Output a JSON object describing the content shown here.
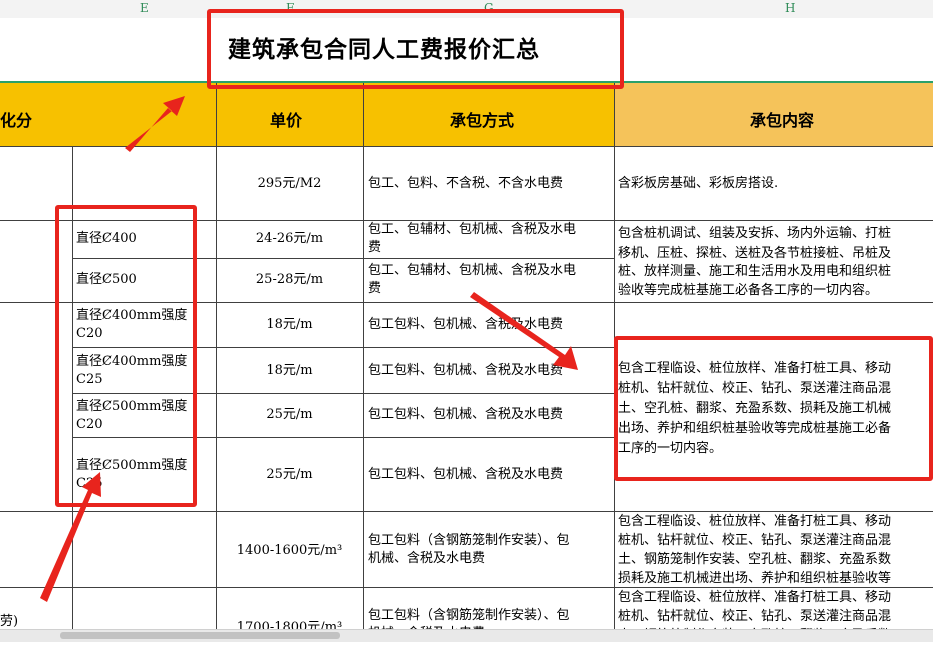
{
  "columns": [
    "E",
    "F",
    "G",
    "H"
  ],
  "title": "建筑承包合同人工费报价汇总",
  "headers": {
    "partial": "化分",
    "unit_price": "单价",
    "method": "承包方式",
    "content": "承包内容"
  },
  "left_edge_text": "劳)",
  "rows": [
    {
      "spec": "",
      "price": "295元/M2",
      "method": "包工、包料、不含税、不含水电费",
      "content": "含彩板房基础、彩板房搭设."
    },
    {
      "spec": "直径Ȼ400",
      "price": "24-26元/m",
      "method": "包工、包辅材、包机械、含税及水电",
      "method2": "费",
      "content": "包含桩机调试、组装及安拆、场内外运输、打桩",
      "content2": "移机、压桩、探桩、送桩及各节桩接桩、吊桩及"
    },
    {
      "spec": "直径Ȼ500",
      "price": "25-28元/m",
      "method": "包工、包辅材、包机械、含税及水电",
      "method2": "费",
      "content": "桩、放样测量、施工和生活用水及用电和组织桩",
      "content2": "验收等完成桩基施工必备各工序的一切内容。"
    },
    {
      "spec": "直径Ȼ400mm强度",
      "spec2": "C20",
      "price": "18元/m",
      "method": "包工包料、包机械、含税及水电费",
      "content": ""
    },
    {
      "spec": "直径Ȼ400mm强度",
      "spec2": "C25",
      "price": "18元/m",
      "method": "包工包料、包机械、含税及水电费",
      "content": ""
    },
    {
      "spec": "直径Ȼ500mm强度",
      "spec2": "C20",
      "price": "25元/m",
      "method": "包工包料、包机械、含税及水电费",
      "content": ""
    },
    {
      "spec": "直径Ȼ500mm强度",
      "spec2": "C25",
      "price": "25元/m",
      "method": "包工包料、包机械、含税及水电费",
      "content": ""
    }
  ],
  "merged_content": [
    "包含工程临设、桩位放样、准备打桩工具、移动",
    "桩机、钻杆就位、校正、钻孔、泵送灌注商品混",
    "土、空孔桩、翻浆、充盈系数、损耗及施工机械",
    "出场、养护和组织桩基验收等完成桩基施工必备",
    "工序的一切内容。"
  ],
  "row8": {
    "price": "1400-1600元/m³",
    "method": "包工包料（含钢筋笼制作安装）、包",
    "method2": "机械、含税及水电费",
    "content": [
      "包含工程临设、桩位放样、准备打桩工具、移动",
      "桩机、钻杆就位、校正、钻孔、泵送灌注商品混",
      "土、钢筋笼制作安装、空孔桩、翻浆、充盈系数",
      "损耗及施工机械进出场、养护和组织桩基验收等"
    ]
  },
  "row9": {
    "price": "1700-1800元/m³",
    "method": "包工包料（含钢筋笼制作安装）、包",
    "method2": "机械、含税及水电费",
    "content": [
      "包含工程临设、桩位放样、准备打桩工具、移动",
      "桩机、钻杆就位、校正、钻孔、泵送灌注商品混",
      "土、钢筋笼制作安装、空孔桩、翻浆、充盈系数"
    ]
  },
  "colors": {
    "header_fill": "#f7c100",
    "header_fill_h": "#f5c35a",
    "annotation_red": "#e8241d",
    "rule_green": "#2aa06a"
  }
}
